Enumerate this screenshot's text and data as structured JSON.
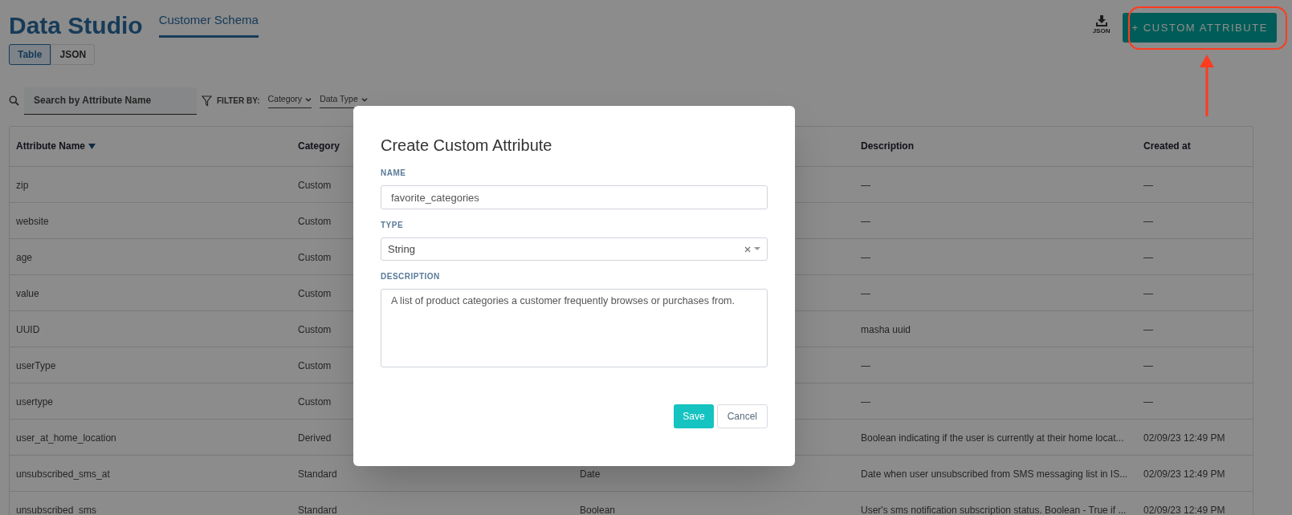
{
  "header": {
    "title": "Data Studio",
    "tabs": [
      {
        "label": "Customer Schema",
        "selected": true
      }
    ],
    "view_toggle": [
      {
        "label": "Table",
        "selected": true
      },
      {
        "label": "JSON",
        "selected": false
      }
    ],
    "download_label": "JSON",
    "add_button": "+ CUSTOM ATTRIBUTE"
  },
  "toolbar": {
    "search": {
      "placeholder": "Search by Attribute Name"
    },
    "filter_label": "FILTER BY:",
    "filters": [
      "Category",
      "Data Type"
    ]
  },
  "table": {
    "columns": [
      {
        "kind": "text",
        "label": "Attribute Name",
        "sorted": true
      },
      {
        "kind": "text",
        "label": "Category"
      },
      {
        "kind": "covered"
      },
      {
        "kind": "text",
        "label": "Description"
      },
      {
        "kind": "text",
        "label": "Created at"
      }
    ],
    "rows": [
      {
        "attribute_name": "zip",
        "category": "Custom",
        "description": "—",
        "created_at": "—"
      },
      {
        "attribute_name": "website",
        "category": "Custom",
        "description": "—",
        "created_at": "—"
      },
      {
        "attribute_name": "age",
        "category": "Custom",
        "description": "—",
        "created_at": "—"
      },
      {
        "attribute_name": "value",
        "category": "Custom",
        "description": "—",
        "created_at": "—"
      },
      {
        "attribute_name": "UUID",
        "category": "Custom",
        "description": "masha uuid",
        "created_at": "—"
      },
      {
        "attribute_name": "userType",
        "category": "Custom",
        "description": "—",
        "created_at": "—"
      },
      {
        "attribute_name": "usertype",
        "category": "Custom",
        "description": "—",
        "created_at": "—"
      },
      {
        "attribute_name": "user_at_home_location",
        "category": "Derived",
        "description": "Boolean indicating if the user is currently at their home locat...",
        "created_at": "02/09/23 12:49 PM"
      },
      {
        "attribute_name": "unsubscribed_sms_at",
        "category": "Standard",
        "column_3": "Date",
        "description": "Date when user unsubscribed from SMS messaging list in IS...",
        "created_at": "02/09/23 12:49 PM"
      },
      {
        "attribute_name": "unsubscribed_sms",
        "category": "Standard",
        "column_3": "Boolean",
        "description": "User's sms notification subscription status. Boolean - True if ...",
        "created_at": "02/09/23 12:49 PM"
      }
    ]
  },
  "modal": {
    "title": "Create Custom Attribute",
    "fields": [
      {
        "kind": "text",
        "label": "NAME",
        "value": "favorite_categories"
      },
      {
        "kind": "select",
        "label": "TYPE",
        "value": "String"
      },
      {
        "kind": "textarea",
        "label": "DESCRIPTION",
        "value": "A list of product categories a customer frequently browses or purchases from."
      }
    ],
    "buttons": [
      {
        "kind": "primary",
        "label": "Save"
      },
      {
        "kind": "secondary",
        "label": "Cancel"
      }
    ]
  }
}
